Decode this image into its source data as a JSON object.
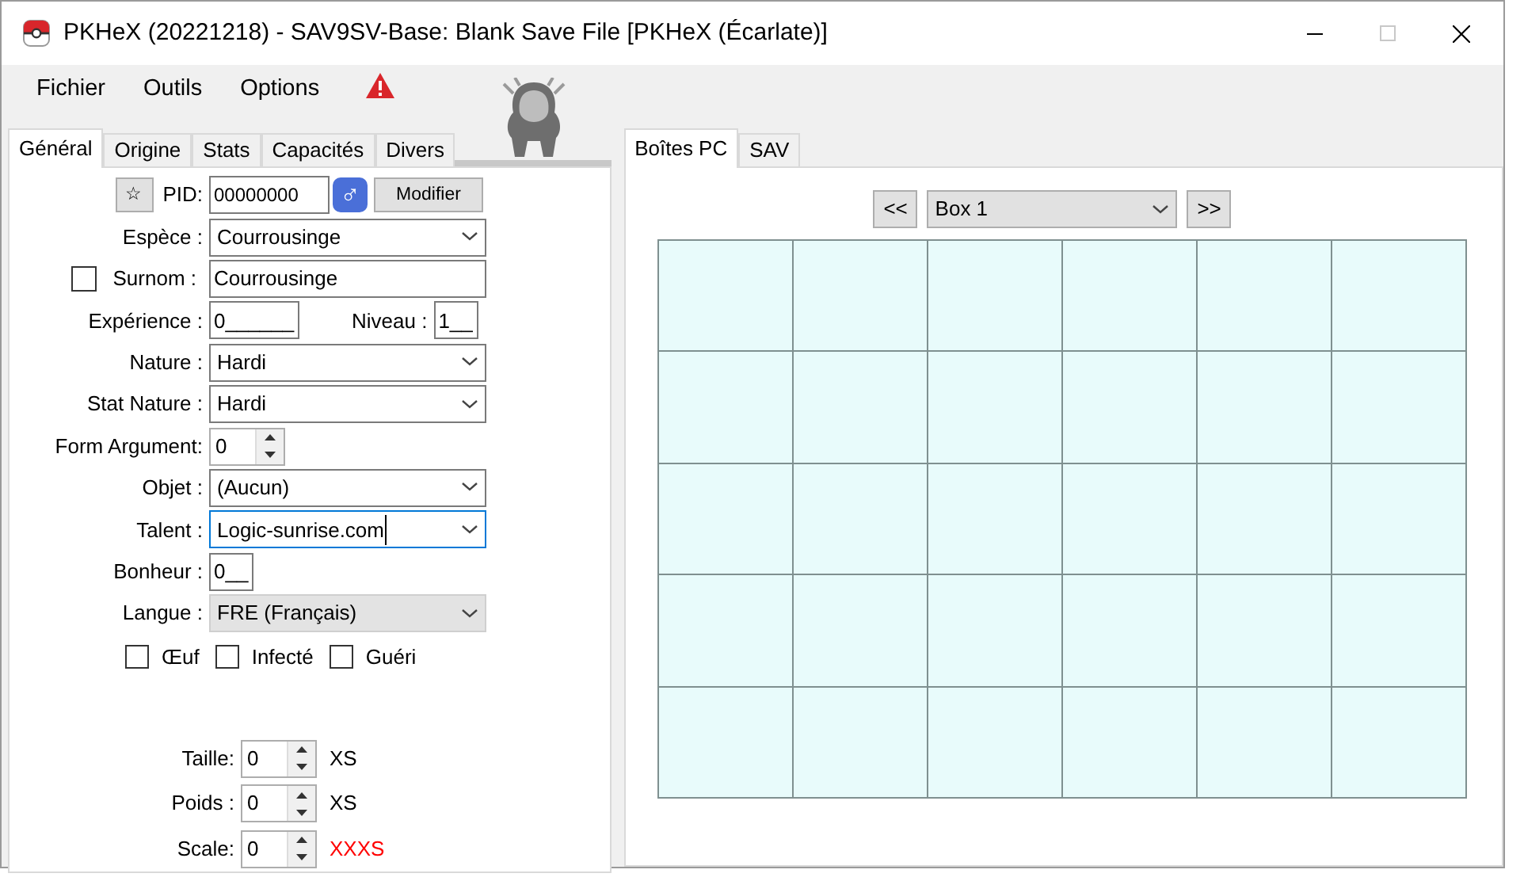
{
  "window": {
    "title": "PKHeX (20221218) - SAV9SV-Base: Blank Save File [PKHeX (Écarlate)]"
  },
  "menu": [
    {
      "label": "Fichier"
    },
    {
      "label": "Outils"
    },
    {
      "label": "Options"
    }
  ],
  "left_tabs": [
    {
      "label": "Général",
      "selected": true
    },
    {
      "label": "Origine",
      "selected": false
    },
    {
      "label": "Stats",
      "selected": false
    },
    {
      "label": "Capacités",
      "selected": false
    },
    {
      "label": "Divers",
      "selected": false
    }
  ],
  "pid": {
    "star": "☆",
    "label": "PID:",
    "value": "00000000",
    "gender": "♂",
    "button": "Modifier"
  },
  "fields": [
    {
      "kind": "select",
      "label": "Espèce :",
      "value": "Courrousinge"
    },
    {
      "kind": "nickname",
      "label": "Surnom :",
      "value": "Courrousinge",
      "checked": false
    },
    {
      "kind": "pair",
      "label": "Expérience :",
      "value": "0______",
      "label2": "Niveau :",
      "value2": "1__"
    },
    {
      "kind": "select",
      "label": "Nature :",
      "value": "Hardi"
    },
    {
      "kind": "select",
      "label": "Stat Nature :",
      "value": "Hardi"
    },
    {
      "kind": "spin",
      "label": "Form Argument:",
      "value": "0"
    },
    {
      "kind": "select",
      "label": "Objet :",
      "value": "(Aucun)"
    },
    {
      "kind": "select",
      "label": "Talent :",
      "value": "Logic-sunrise.com",
      "focused": true
    },
    {
      "kind": "short",
      "label": "Bonheur :",
      "value": "0__"
    },
    {
      "kind": "select",
      "label": "Langue :",
      "value": "FRE (Français)",
      "disabled": true
    }
  ],
  "checkboxes": [
    {
      "label": "Œuf",
      "checked": false
    },
    {
      "label": "Infecté",
      "checked": false
    },
    {
      "label": "Guéri",
      "checked": false
    }
  ],
  "sizes": [
    {
      "label": "Taille:",
      "value": "0",
      "rating": "XS",
      "color": "#000000"
    },
    {
      "label": "Poids :",
      "value": "0",
      "rating": "XS",
      "color": "#000000"
    },
    {
      "label": "Scale:",
      "value": "0",
      "rating": "XXXS",
      "color": "#ff0000"
    }
  ],
  "right_tabs": [
    {
      "label": "Boîtes PC",
      "selected": true
    },
    {
      "label": "SAV",
      "selected": false
    }
  ],
  "box": {
    "prev": "<<",
    "name": "Box 1",
    "next": ">>",
    "rows": [
      [
        {
          "kind": "empty"
        },
        {
          "kind": "empty"
        },
        {
          "kind": "empty"
        },
        {
          "kind": "empty"
        },
        {
          "kind": "empty"
        },
        {
          "kind": "empty"
        }
      ],
      [
        {
          "kind": "empty"
        },
        {
          "kind": "empty"
        },
        {
          "kind": "empty"
        },
        {
          "kind": "empty"
        },
        {
          "kind": "empty"
        },
        {
          "kind": "empty"
        }
      ],
      [
        {
          "kind": "empty"
        },
        {
          "kind": "empty"
        },
        {
          "kind": "empty"
        },
        {
          "kind": "empty"
        },
        {
          "kind": "empty"
        },
        {
          "kind": "empty"
        }
      ],
      [
        {
          "kind": "empty"
        },
        {
          "kind": "empty"
        },
        {
          "kind": "empty"
        },
        {
          "kind": "empty"
        },
        {
          "kind": "empty"
        },
        {
          "kind": "empty"
        }
      ],
      [
        {
          "kind": "empty"
        },
        {
          "kind": "empty"
        },
        {
          "kind": "empty"
        },
        {
          "kind": "empty"
        },
        {
          "kind": "empty"
        },
        {
          "kind": "empty"
        }
      ]
    ]
  }
}
